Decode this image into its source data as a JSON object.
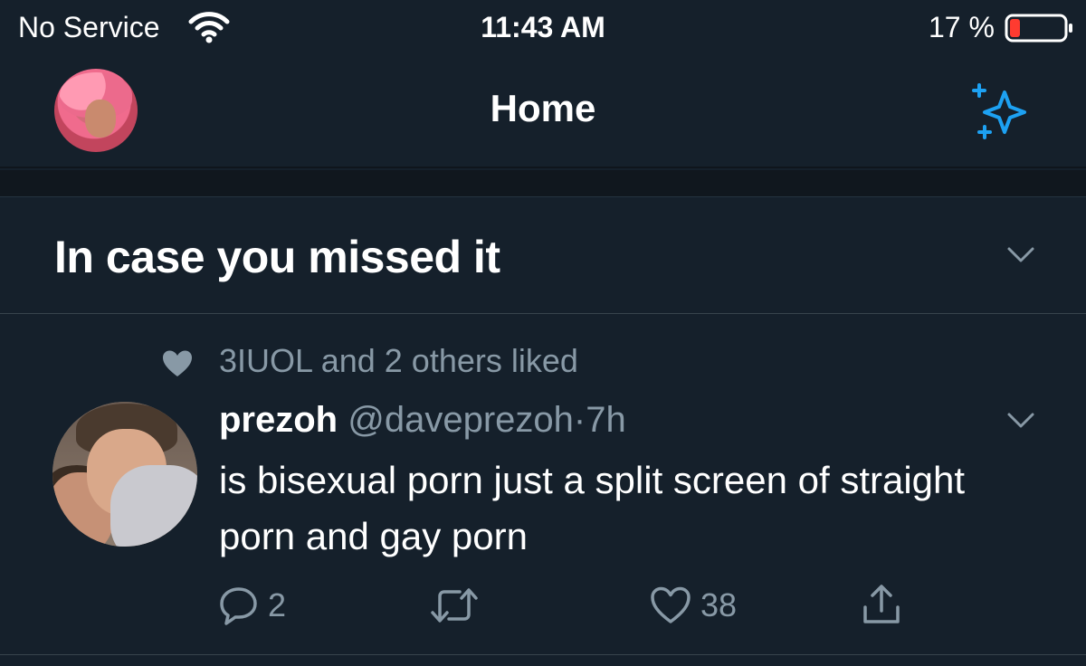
{
  "status_bar": {
    "carrier": "No Service",
    "time": "11:43 AM",
    "battery_percent": "17 %",
    "battery_level": 0.17,
    "battery_color": "#ff3b30"
  },
  "header": {
    "title": "Home",
    "avatar_icon": "profile-avatar",
    "right_icon": "sparkle-icon",
    "accent": "#1da1f2"
  },
  "section": {
    "title": "In case you missed it",
    "chevron_icon": "chevron-down-icon"
  },
  "tweet": {
    "social_context": "3IUOL and 2 others liked",
    "author_name": "prezoh",
    "handle": "@daveprezoh",
    "separator": "·",
    "time": "7h",
    "text": "is bisexual porn just a split screen of straight porn and gay porn",
    "actions": {
      "reply_count": "2",
      "retweet_count": "",
      "like_count": "38"
    }
  },
  "colors": {
    "background": "#15202b",
    "secondary_text": "#8899a6",
    "divider": "#38444d"
  }
}
